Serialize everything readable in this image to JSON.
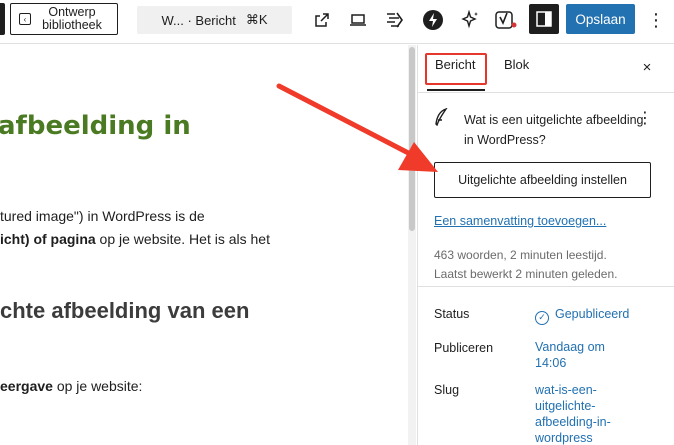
{
  "toolbar": {
    "pattern_button_label": "Ontwerp bibliotheek",
    "document_bar": {
      "title": "W... · Bericht",
      "shortcut": "⌘K"
    },
    "save_label": "Opslaan",
    "more_label": "⋮"
  },
  "canvas": {
    "heading": "afbeelding in",
    "paragraph1_line1": "tured image\") in WordPress is de",
    "paragraph1_line2_bold": "icht) of pagina",
    "paragraph1_line2_rest": " op je website. Het is als het",
    "heading2": "chte afbeelding van een",
    "paragraph2_bold": "eergave",
    "paragraph2_rest": " op je website:"
  },
  "sidebar": {
    "tabs": [
      {
        "label": "Bericht",
        "active": true
      },
      {
        "label": "Blok",
        "active": false
      }
    ],
    "close_label": "×",
    "post_title": "Wat is een uitgelichte afbeelding in WordPress?",
    "post_more": "⋮",
    "featured_image_button": "Uitgelichte afbeelding instellen",
    "excerpt_link": "Een samenvatting toevoegen...",
    "stats": "463 woorden, 2 minuten leestijd.",
    "last_edited": "Laatst bewerkt 2 minuten geleden.",
    "rows": [
      {
        "label": "Status",
        "value": "Gepubliceerd"
      },
      {
        "label": "Publiceren",
        "value": "Vandaag om 14:06"
      },
      {
        "label": "Slug",
        "value": "wat-is-een-uitgelichte-afbeelding-in-wordpress"
      }
    ]
  },
  "colors": {
    "accent": "#2271b1",
    "heading_green": "#4a7a22",
    "highlight_red": "#e5372b",
    "arrow_red": "#f03a2a"
  }
}
